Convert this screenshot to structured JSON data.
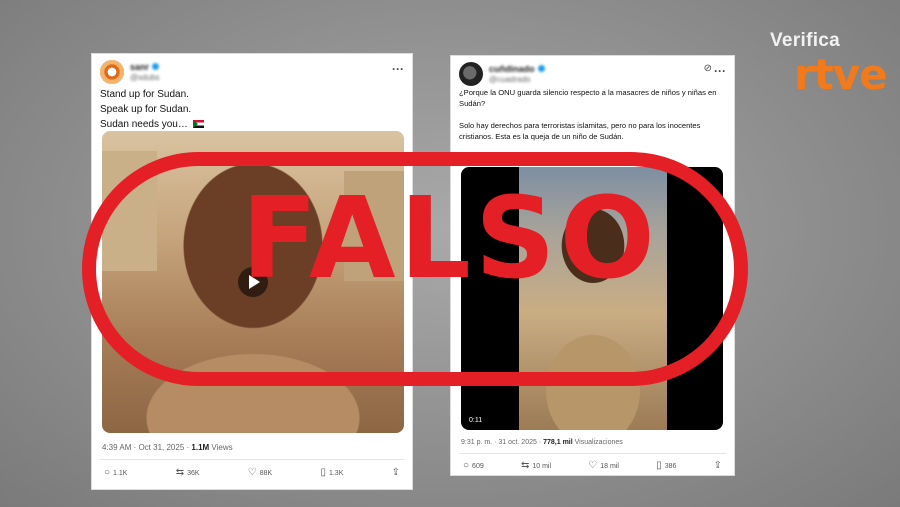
{
  "brand": {
    "verifica": "Verifica",
    "rtve": "rtve"
  },
  "stamp": {
    "label": "FALSO",
    "color": "#e41f26"
  },
  "colors": {
    "brand_orange": "#f07a1c",
    "verified": "#1d9bf0"
  },
  "left_post": {
    "display_name": "sanr",
    "handle": "@sdubs",
    "lines": [
      "Stand up for Sudan.",
      "Speak up for Sudan.",
      "Sudan needs you…"
    ],
    "meta_time": "4:39 AM · Oct 31, 2025 · ",
    "meta_views_count": "1.1M",
    "meta_views_label": " Views",
    "actions": {
      "replies": "1.1K",
      "reposts": "36K",
      "likes": "88K",
      "bookmarks": "1.3K"
    }
  },
  "right_post": {
    "display_name": "cuñdinado",
    "handle": "@cuadrado",
    "para1": "¿Porque la ONU guarda silencio respecto a la masacres de niños y niñas en Sudán?",
    "para2": "Solo hay derechos para terroristas islamitas, pero no para los inocentes cristianos. Esta es la queja de un niño de Sudán.",
    "video_duration": "0:11",
    "meta_time": "9:31 p. m. · 31 oct. 2025 · ",
    "meta_views_count": "778,1 mil",
    "meta_views_label": " Visualizaciones",
    "actions": {
      "replies": "609",
      "reposts": "10 mil",
      "likes": "18 mil",
      "bookmarks": "386"
    }
  },
  "icons": [
    "more-icon",
    "grok-icon",
    "verified-icon",
    "flag-sudan-icon",
    "play-icon",
    "reply-icon",
    "repost-icon",
    "like-icon",
    "bookmark-icon",
    "share-icon"
  ]
}
